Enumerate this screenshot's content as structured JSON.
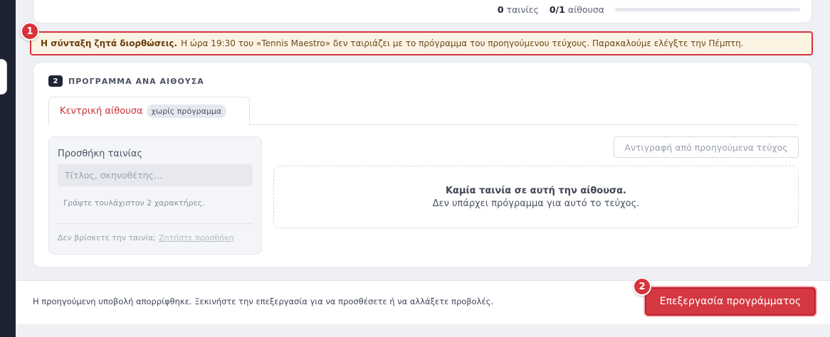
{
  "stats": {
    "films_count": "0",
    "films_label": "ταινίες",
    "rooms_count": "0/1",
    "rooms_label": "αίθουσα",
    "rooms_progress": 0
  },
  "alert": {
    "marker": "1",
    "strong": "Η σύνταξη ζητά διορθώσεις.",
    "text": "Η ώρα 19:30 του «Tennis Maestro» δεν ταιριάζει με το πρόγραμμα του προηγούμενου τεύχους. Παρακαλούμε ελέγξτε την Πέμπτη."
  },
  "section": {
    "step_number": "2",
    "title": "ΠΡΟΓΡΑΜΜΑ ΑΝΑ ΑΙΘΟΥΣΑ",
    "tabs": [
      {
        "label": "Κεντρική αίθουσα",
        "chip": "χωρίς πρόγραμμα"
      }
    ]
  },
  "add_film": {
    "title": "Προσθήκη ταινίας",
    "placeholder": "Τίτλος, σκηνοθέτης…",
    "hint": "Γράψτε τουλάχιστον 2 χαρακτήρες.",
    "footer_text": "Δεν βρίσκετε την ταινία;",
    "footer_link": "Ζητήστε προσθήκη"
  },
  "copy_button": "Αντιγραφή από προηγούμενα τεύχος",
  "empty_state": {
    "title": "Καμία ταινία σε αυτή την αίθουσα.",
    "subtitle": "Δεν υπάρχει πρόγραμμα για αυτό το τεύχος."
  },
  "footer": {
    "text": "Η προηγούμενη υποβολή απορρίφθηκε. Ξεκινήστε την επεξεργασία για να προσθέσετε ή να αλλάξετε προβολές.",
    "marker": "2",
    "edit_button": "Επεξεργασία προγράμματος"
  },
  "colors": {
    "accent_red": "#d43841",
    "alert_bg": "#fdf3e3",
    "sidebar": "#1d2230"
  }
}
